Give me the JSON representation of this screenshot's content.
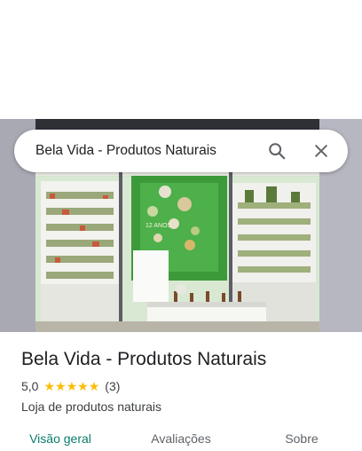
{
  "search": {
    "query": "Bela Vida - Produtos Naturais",
    "search_icon": "search-icon",
    "close_icon": "close-icon"
  },
  "hero": {
    "image_kind": "storefront-photo",
    "wall_sign_text": "12 ANOS"
  },
  "place": {
    "name": "Bela Vida - Produtos Naturais",
    "rating": "5,0",
    "stars": 5,
    "review_count": "(3)",
    "category": "Loja de produtos naturais"
  },
  "tabs": [
    {
      "label": "Visão geral",
      "active": true
    },
    {
      "label": "Avaliações",
      "active": false
    },
    {
      "label": "Sobre",
      "active": false
    }
  ],
  "colors": {
    "active_tab": "#0b7c6e",
    "star": "#fbbc04",
    "text_primary": "#202124",
    "text_secondary": "#3c4043"
  }
}
